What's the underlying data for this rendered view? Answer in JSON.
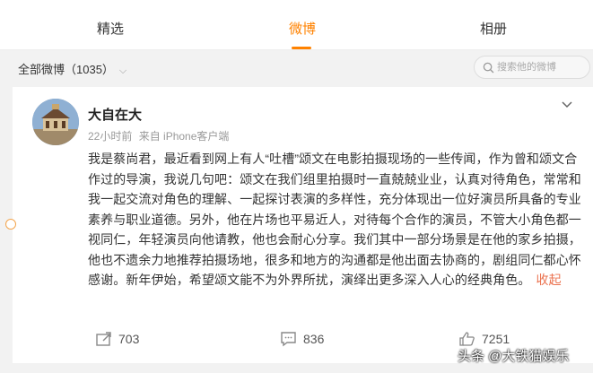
{
  "tabs": [
    {
      "label": "精选"
    },
    {
      "label": "微博"
    },
    {
      "label": "相册"
    }
  ],
  "filter": {
    "label": "全部微博（1035）",
    "search_placeholder": "搜索他的微博"
  },
  "post": {
    "author": "大自在大",
    "time": "22小时前",
    "source": "来自 iPhone客户端",
    "text": "我是蔡尚君，最近看到网上有人“吐槽”颂文在电影拍摄现场的一些传闻，作为曾和颂文合作过的导演，我说几句吧：颂文在我们组里拍摄时一直兢兢业业，认真对待角色，常常和我一起交流对角色的理解、一起探讨表演的多样性，充分体现出一位好演员所具备的专业素养与职业道德。另外，他在片场也平易近人，对待每个合作的演员，不管大小角色都一视同仁，年轻演员向他请教，他也会耐心分享。我们其中一部分场景是在他的家乡拍摄，他也不遗余力地推荐拍摄场地，很多和地方的沟通都是他出面去协商的，剧组同仁都心怀感谢。新年伊始，希望颂文能不为外界所扰，演绎出更多深入人心的经典角色。",
    "collapse_label": "收起",
    "shares": "703",
    "comments": "836",
    "likes": "7251"
  },
  "watermark": "头条 @大铁猫娱乐",
  "colors": {
    "accent": "#ff8200",
    "link": "#eb7350"
  }
}
